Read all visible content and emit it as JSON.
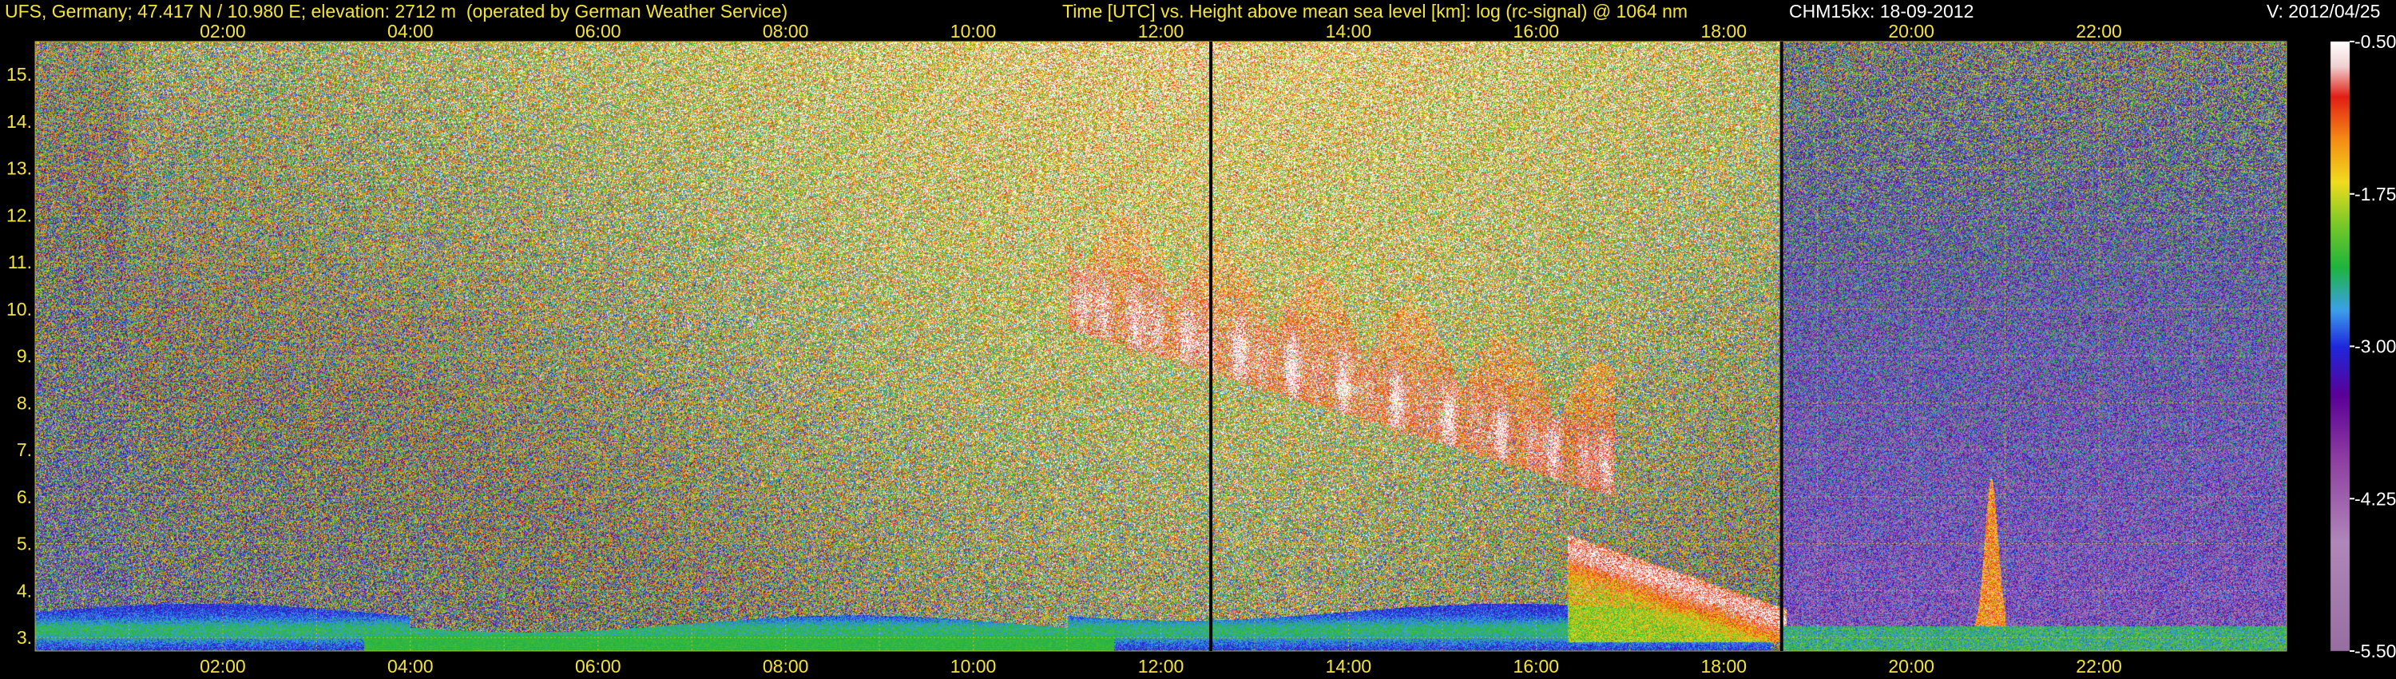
{
  "header": {
    "station": "UFS, Germany; 47.417 N / 10.980 E; elevation: 2712 m  (operated by German Weather Service)",
    "plot_description": "Time [UTC] vs. Height above mean sea level [km]: log (rc-signal) @ 1064 nm",
    "instrument_date": "CHM15kx: 18-09-2012",
    "version": "V: 2012/04/25"
  },
  "colors": {
    "header_text": "#f4e43a",
    "tick_text": "#f4e43a",
    "grid": "#d8c82a",
    "background": "#000000"
  },
  "chart_data": {
    "type": "heatmap",
    "title": "Time [UTC] vs. Height above mean sea level [km]: log (rc-signal) @ 1064 nm",
    "x_ticks": [
      "02:00",
      "04:00",
      "06:00",
      "08:00",
      "10:00",
      "12:00",
      "14:00",
      "16:00",
      "18:00",
      "20:00",
      "22:00"
    ],
    "x_tick_hours": [
      2,
      4,
      6,
      8,
      10,
      12,
      14,
      16,
      18,
      20,
      22
    ],
    "xlim_hours": [
      0,
      24
    ],
    "y_ticks": [
      "3.",
      "4.",
      "5.",
      "6.",
      "7.",
      "8.",
      "9.",
      "10.",
      "11.",
      "12.",
      "13.",
      "14.",
      "15."
    ],
    "y_tick_values": [
      3,
      4,
      5,
      6,
      7,
      8,
      9,
      10,
      11,
      12,
      13,
      14,
      15
    ],
    "ylim_km": [
      2.712,
      15.7
    ],
    "grid": true,
    "colorbar": {
      "range": [
        -5.5,
        -0.5
      ],
      "ticks": [
        "-0.50",
        "-1.75",
        "-3.00",
        "-4.25",
        "-5.50"
      ],
      "tick_values": [
        -0.5,
        -1.75,
        -3.0,
        -4.25,
        -5.5
      ]
    },
    "data_gaps_utc": [
      "12:32",
      "18:37"
    ],
    "features": [
      {
        "name": "boundary layer aerosol",
        "time_utc": [
          "00:00",
          "18:30"
        ],
        "height_km": [
          2.8,
          3.8
        ]
      },
      {
        "name": "cirrus cloud",
        "time_utc": [
          "11:00",
          "16:50"
        ],
        "height_km": [
          6.0,
          12.3
        ]
      },
      {
        "name": "low cloud",
        "time_utc": [
          "16:20",
          "18:40"
        ],
        "height_km": [
          2.9,
          5.3
        ]
      },
      {
        "name": "cloud tower",
        "time_utc": [
          "20:40",
          "21:00"
        ],
        "height_km": [
          3.0,
          6.4
        ]
      }
    ]
  }
}
